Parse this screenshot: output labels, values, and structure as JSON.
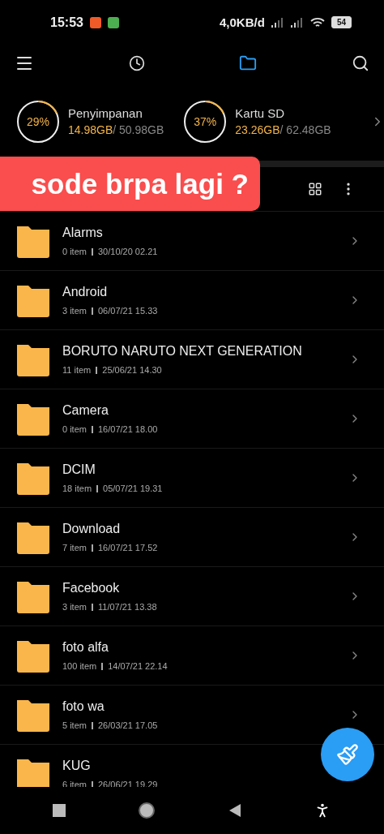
{
  "status_bar": {
    "time": "15:53",
    "net_speed": "4,0KB/d",
    "battery": "54"
  },
  "tabs": [
    {
      "kind": "recent",
      "selected": false
    },
    {
      "kind": "files",
      "selected": true
    }
  ],
  "storage": [
    {
      "name": "Penyimpanan",
      "percent": "29%",
      "used": "14.98GB",
      "total": "/ 50.98GB"
    },
    {
      "name": "Kartu SD",
      "percent": "37%",
      "used": "23.26GB",
      "total": "/ 62.48GB"
    }
  ],
  "banner": {
    "text": "sode brpa lagi ?"
  },
  "folders": [
    {
      "name": "Alarms",
      "count": "0 item",
      "date": "30/10/20 02.21"
    },
    {
      "name": "Android",
      "count": "3 item",
      "date": "06/07/21 15.33"
    },
    {
      "name": "BORUTO NARUTO NEXT GENERATION",
      "count": "11 item",
      "date": "25/06/21 14.30"
    },
    {
      "name": "Camera",
      "count": "0 item",
      "date": "16/07/21 18.00"
    },
    {
      "name": "DCIM",
      "count": "18 item",
      "date": "05/07/21 19.31"
    },
    {
      "name": "Download",
      "count": "7 item",
      "date": "16/07/21 17.52"
    },
    {
      "name": "Facebook",
      "count": "3 item",
      "date": "11/07/21 13.38"
    },
    {
      "name": "foto alfa",
      "count": "100 item",
      "date": "14/07/21 22.14"
    },
    {
      "name": "foto wa",
      "count": "5 item",
      "date": "26/03/21 17.05"
    },
    {
      "name": "KUG",
      "count": "6 item",
      "date": "26/06/21 19.29"
    }
  ]
}
